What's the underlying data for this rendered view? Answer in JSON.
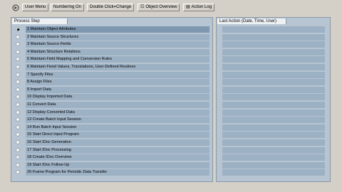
{
  "toolbar": {
    "user_menu": "User Menu",
    "numbering_on": "Numbering On",
    "double_click_change": "Double Click=Change",
    "object_overview": "Object Overview",
    "action_log": "Action Log"
  },
  "left_panel": {
    "header": "Process Step",
    "steps": [
      "1 Maintain Object Attributes",
      "2 Maintain Source Structures",
      "3 Maintain Source Fields",
      "4 Maintain Structure Relations",
      "5 Maintain Field Mapping and Conversion Rules",
      "6 Maintain Fixed Values, Translations, User-Defined Routines",
      "7 Specify Files",
      "8 Assign Files",
      "9 Import Data",
      "10 Display Imported Data",
      "11 Convert Data",
      "12 Display Converted Data",
      "13 Create Batch Input Session",
      "14 Run Batch Input Session",
      "15 Start Direct Input Program",
      "16 Start IDoc Generation",
      "17 Start IDoc Processing",
      "18 Create IDoc Overview",
      "19 Start IDoc Follow-Up",
      "20 Frame Program for Periodic Data Transfer"
    ]
  },
  "right_panel": {
    "header": "Last Action (Date, Time, User)"
  }
}
